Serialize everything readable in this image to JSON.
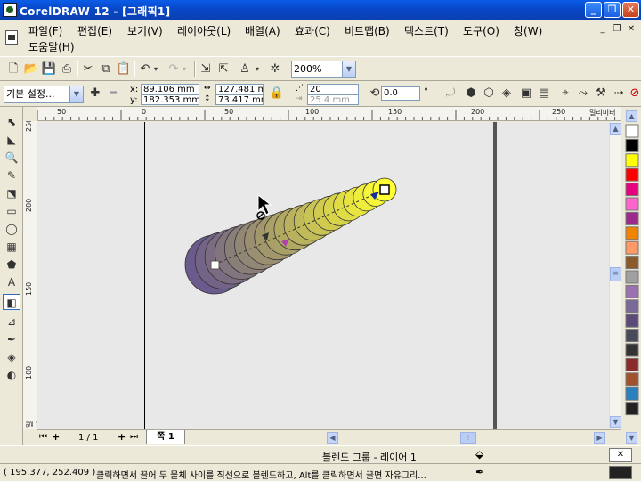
{
  "window": {
    "title": "CorelDRAW 12 - [그래픽1]",
    "minimize_glyph": "_",
    "maximize_glyph": "❐",
    "close_glyph": "✕"
  },
  "menu": {
    "items": [
      {
        "label": "파일(F)"
      },
      {
        "label": "편집(E)"
      },
      {
        "label": "보기(V)"
      },
      {
        "label": "레이아웃(L)"
      },
      {
        "label": "배열(A)"
      },
      {
        "label": "효과(C)"
      },
      {
        "label": "비트맵(B)"
      },
      {
        "label": "텍스트(T)"
      },
      {
        "label": "도구(O)"
      },
      {
        "label": "창(W)"
      },
      {
        "label": "도움말(H)"
      }
    ],
    "doc_controls": [
      "_",
      "❐",
      "✕"
    ]
  },
  "standard_toolbar": {
    "zoom_value": "200%"
  },
  "property_bar": {
    "preset": "기본 설정...",
    "x_label": "x:",
    "x_value": "89.106 mm",
    "y_label": "y:",
    "y_value": "182.353 mm",
    "width_value": "127.481 mr",
    "height_value": "73.417 mm",
    "steps_value": "20",
    "spacing_value": "25.4 mm",
    "rotation_value": "0.0",
    "degree": "°"
  },
  "rulers": {
    "h_ticks": [
      "50",
      "0",
      "50",
      "100",
      "150",
      "200",
      "250"
    ],
    "h_unit": "밀리미터",
    "v_ticks": [
      "250",
      "200",
      "150",
      "100"
    ],
    "v_unit": "밀리미터"
  },
  "tools": [
    "pick",
    "shape",
    "zoom",
    "freehand",
    "smart-fill",
    "rectangle",
    "ellipse",
    "polygon",
    "basic-shapes",
    "text",
    "interactive-blend",
    "eyedropper",
    "outline",
    "fill",
    "interactive-fill"
  ],
  "palette_colors": [
    "#ffffff",
    "#000000",
    "#ffff00",
    "#ff0000",
    "#e6007e",
    "#ff66cc",
    "#9c2a8c",
    "#f08300",
    "#ff9966",
    "#8b5a2b",
    "#a0a0a0",
    "#9b72b0",
    "#7a6a9a",
    "#5b4a7a",
    "#4a4a5a",
    "#333333",
    "#8b2a2a",
    "#a0522d",
    "#2a7fbf",
    "#222222"
  ],
  "page_nav": {
    "page_count": "1 / 1",
    "page_tab": "쪽 1"
  },
  "status": {
    "object_info": "블렌드 그룹 - 레이어 1",
    "coords": "( 195.377, 252.409 )",
    "hint": "클릭하면서 끌어 두 물체 사이를 직선으로 블렌드하고, Alt를 클릭하면서 끌면 자유그리..."
  },
  "colors": {
    "title_blue": "#0a5de8",
    "blend_start": "#6b5b8c",
    "blend_end": "#ffff33"
  }
}
